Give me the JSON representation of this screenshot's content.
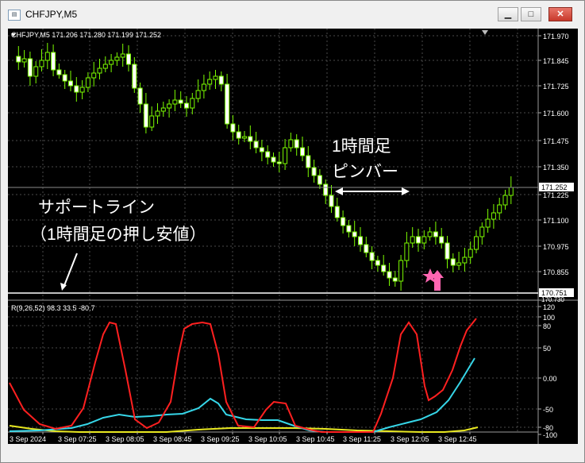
{
  "window": {
    "title": "CHFJPY,M5",
    "minimize_label": "▁",
    "maximize_label": "□",
    "close_label": "✕"
  },
  "main_panel": {
    "info": "CHFJPY,M5  171.206 171.280 171.199 171.252",
    "price_labels": [
      "171.970",
      "171.845",
      "171.725",
      "171.600",
      "171.475",
      "171.350",
      "171.225",
      "171.100",
      "170.975",
      "170.855"
    ],
    "current_price": "171.252",
    "low_price_tag": "170.751",
    "low_price_tag_under": "170.730"
  },
  "annotations": {
    "pinbar_line1": "1時間足",
    "pinbar_line2": "ピンバー",
    "support_line1": "サポートライン",
    "support_line2": "（1時間足の押し安値）"
  },
  "indicator_panel": {
    "info": "R(9,26,52) 98.3 33.5 -80.7",
    "labels": [
      "120",
      "100",
      "80",
      "50",
      "0.00",
      "-50",
      "-80",
      "-100"
    ]
  },
  "time_axis": {
    "labels": [
      "3 Sep 2024",
      "3 Sep 07:25",
      "3 Sep 08:05",
      "3 Sep 08:45",
      "3 Sep 09:25",
      "3 Sep 10:05",
      "3 Sep 10:45",
      "3 Sep 11:25",
      "3 Sep 12:05",
      "3 Sep 12:45"
    ]
  },
  "colors": {
    "background": "#000000",
    "grid": "#5a5a5a",
    "candle": "#7CFC00",
    "candle_bear_fill": "#ffffff",
    "red_line": "#ff2020",
    "cyan_line": "#36d6e8",
    "yellow_line": "#e8e820",
    "pink_marker": "#ff66b2",
    "text": "#ffffff"
  }
}
